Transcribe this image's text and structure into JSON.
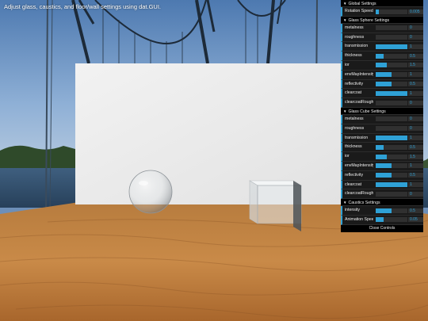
{
  "info_text": "Adjust glass, caustics, and floor/wall settings using dat.GUI.",
  "gui": {
    "global": {
      "title": "Global Settings",
      "rows": [
        {
          "label": "Rotation Speed",
          "value": "0.005",
          "level": 0.1
        }
      ]
    },
    "sphere": {
      "title": "Glass Sphere Settings",
      "rows": [
        {
          "label": "metalness",
          "value": "0",
          "level": 0
        },
        {
          "label": "roughness",
          "value": "0",
          "level": 0
        },
        {
          "label": "transmission",
          "value": "1",
          "level": 1
        },
        {
          "label": "thickness",
          "value": "0.5",
          "level": 0.25
        },
        {
          "label": "ior",
          "value": "1.5",
          "level": 0.35
        },
        {
          "label": "envMapIntensity",
          "value": "1",
          "level": 0.5
        },
        {
          "label": "reflectivity",
          "value": "0.5",
          "level": 0.5
        },
        {
          "label": "clearcoat",
          "value": "1",
          "level": 1
        },
        {
          "label": "clearcoatRough...",
          "value": "0",
          "level": 0
        }
      ]
    },
    "cube": {
      "title": "Glass Cube Settings",
      "rows": [
        {
          "label": "metalness",
          "value": "0",
          "level": 0
        },
        {
          "label": "roughness",
          "value": "0",
          "level": 0
        },
        {
          "label": "transmission",
          "value": "1",
          "level": 1
        },
        {
          "label": "thickness",
          "value": "0.5",
          "level": 0.25
        },
        {
          "label": "ior",
          "value": "1.5",
          "level": 0.35
        },
        {
          "label": "envMapIntensity",
          "value": "1",
          "level": 0.5
        },
        {
          "label": "reflectivity",
          "value": "0.5",
          "level": 0.5
        },
        {
          "label": "clearcoat",
          "value": "1",
          "level": 1
        },
        {
          "label": "clearcoatRough...",
          "value": "0",
          "level": 0
        }
      ]
    },
    "caustics": {
      "title": "Caustics Settings",
      "rows": [
        {
          "label": "intensity",
          "value": "0.5",
          "level": 0.5
        },
        {
          "label": "Animation Speed",
          "value": "0.05",
          "level": 0.25
        }
      ]
    },
    "close_label": "Close Controls",
    "accent_color": "#2fa1d6"
  }
}
